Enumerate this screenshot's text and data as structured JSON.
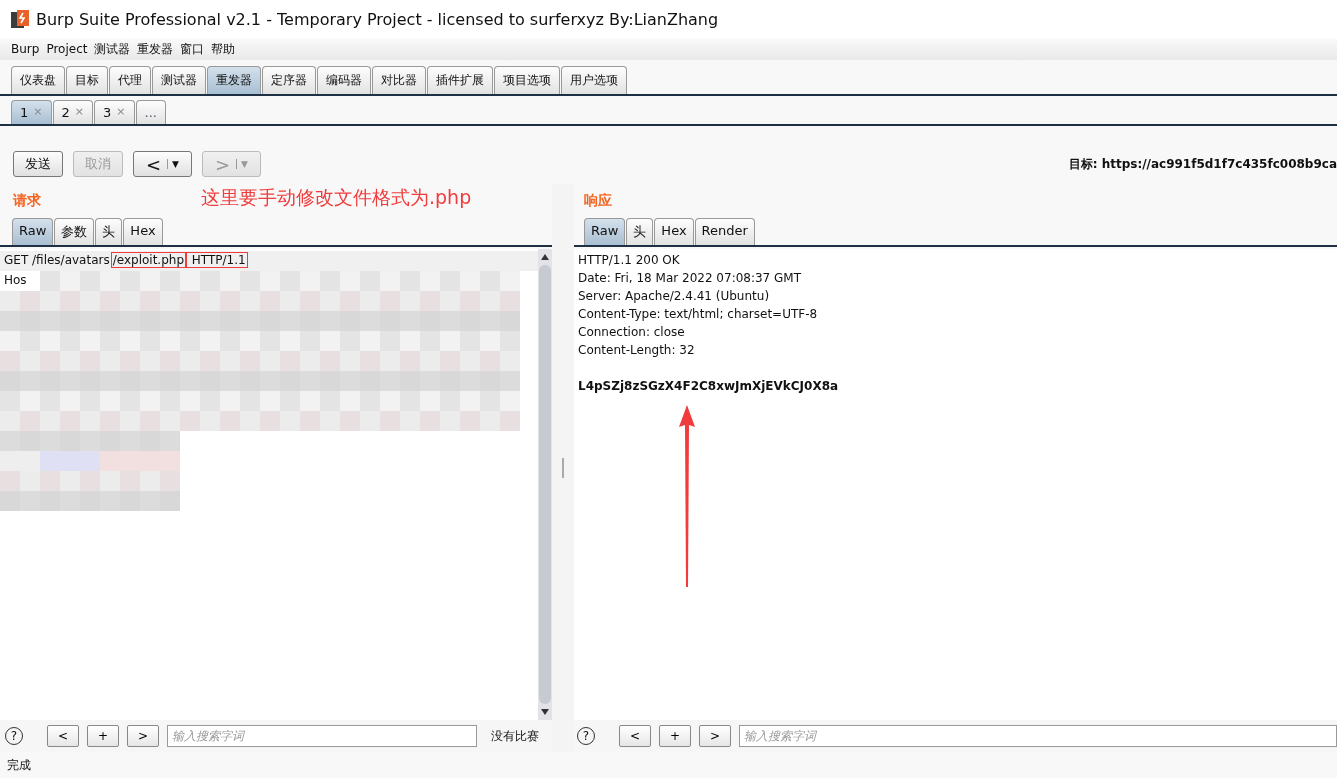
{
  "window": {
    "title": "Burp Suite Professional v2.1 - Temporary Project - licensed to surferxyz By:LianZhang"
  },
  "menu": [
    "Burp",
    "Project",
    "测试器",
    "重发器",
    "窗口",
    "帮助"
  ],
  "tabs": [
    {
      "label": "仪表盘",
      "selected": false
    },
    {
      "label": "目标",
      "selected": false
    },
    {
      "label": "代理",
      "selected": false
    },
    {
      "label": "测试器",
      "selected": false
    },
    {
      "label": "重发器",
      "selected": true
    },
    {
      "label": "定序器",
      "selected": false
    },
    {
      "label": "编码器",
      "selected": false
    },
    {
      "label": "对比器",
      "selected": false
    },
    {
      "label": "插件扩展",
      "selected": false
    },
    {
      "label": "项目选项",
      "selected": false
    },
    {
      "label": "用户选项",
      "selected": false
    }
  ],
  "sub_tabs": [
    {
      "kind": "numbered",
      "label": "1",
      "close": "×",
      "selected": true
    },
    {
      "kind": "numbered",
      "label": "2",
      "close": "×",
      "selected": false
    },
    {
      "kind": "numbered",
      "label": "3",
      "close": "×",
      "selected": false
    },
    {
      "kind": "more",
      "label": "...",
      "selected": false
    }
  ],
  "toolbar": {
    "send": {
      "label": "发送",
      "disabled": false
    },
    "cancel": {
      "label": "取消",
      "disabled": true
    },
    "back": {
      "arrow": "<",
      "caret": "▼",
      "disabled": false
    },
    "forward": {
      "arrow": ">",
      "caret": "▼",
      "disabled": true
    },
    "target_label": "目标:",
    "target_url": "https://ac991f5d1f7c435fc008b9ca"
  },
  "request": {
    "heading": "请求",
    "annotation": "这里要手动修改文件格式为.php",
    "tabs": [
      {
        "label": "Raw",
        "selected": true
      },
      {
        "label": "参数",
        "selected": false
      },
      {
        "label": "头",
        "selected": false
      },
      {
        "label": "Hex",
        "selected": false
      }
    ],
    "first_line": [
      {
        "text": "GET /files/avatars",
        "boxed": false
      },
      {
        "text": "/exploit.php",
        "boxed": true
      },
      {
        "text": " HTTP/1.1",
        "boxed": true
      }
    ],
    "lines": [
      "Hos"
    ]
  },
  "response": {
    "heading": "响应",
    "tabs": [
      {
        "label": "Raw",
        "selected": true
      },
      {
        "label": "头",
        "selected": false
      },
      {
        "label": "Hex",
        "selected": false
      },
      {
        "label": "Render",
        "selected": false
      }
    ],
    "lines": [
      "HTTP/1.1 200 OK",
      "Date: Fri, 18 Mar 2022 07:08:37 GMT",
      "Server: Apache/2.4.41 (Ubuntu)",
      "Content-Type: text/html; charset=UTF-8",
      "Connection: close",
      "Content-Length: 32"
    ],
    "body": "L4pSZj8zSGzX4F2C8xwJmXjEVkCJ0X8a"
  },
  "search_bars": [
    {
      "help": "?",
      "prev": "<",
      "add": "+",
      "next": ">",
      "placeholder": "输入搜索字词",
      "matches": "没有比赛"
    },
    {
      "help": "?",
      "prev": "<",
      "add": "+",
      "next": ">",
      "placeholder": "输入搜索字词"
    }
  ],
  "status_bar": "完成"
}
